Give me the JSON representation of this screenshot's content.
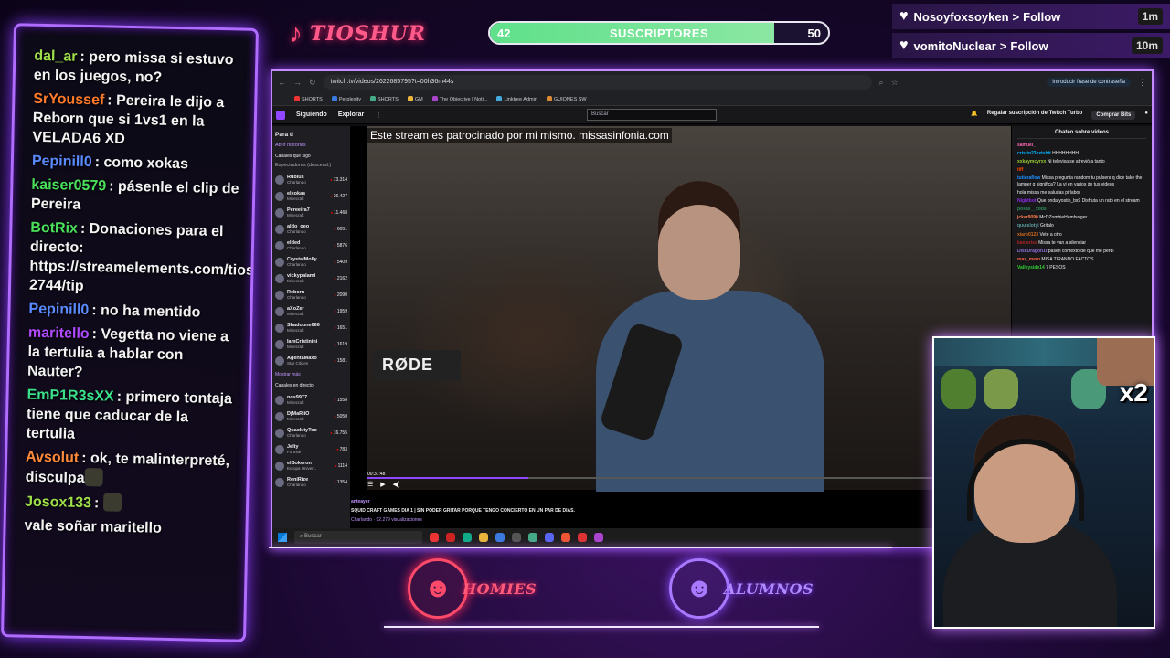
{
  "overlay": {
    "brand": "TIOSHUR",
    "subs": {
      "current": "42",
      "label": "SUSCRIPTORES",
      "goal": "50",
      "progress": 0.84
    },
    "follows": [
      {
        "user": "Nosoyfoxsoyken",
        "action": "Follow",
        "time": "1m"
      },
      {
        "user": "vomitoNuclear",
        "action": "Follow",
        "time": "10m"
      }
    ],
    "logos": {
      "homies": "HOMIES",
      "alumnos": "ALUMNOS"
    },
    "webcam_multiplier": "x2"
  },
  "overlay_chat": [
    {
      "user": "dal_ar",
      "color": "#9fe04a",
      "text": "pero missa si estuvo en los juegos, no?"
    },
    {
      "user": "SrYoussef",
      "color": "#ff7a2a",
      "text": "Pereira le dijo a Reborn que si 1vs1 en la VELADA6 XD"
    },
    {
      "user": "Pepinill0",
      "color": "#5a8aff",
      "text": "como xokas"
    },
    {
      "user": "kaiser0579",
      "color": "#4ae05a",
      "text": "pásenle el clip de Pereira"
    },
    {
      "user": "BotRix",
      "color": "#4ae05a",
      "text": "Donaciones para el directo: https://streamelements.com/tioshur-2744/tip"
    },
    {
      "user": "Pepinill0",
      "color": "#5a8aff",
      "text": "no ha mentido"
    },
    {
      "user": "maritello",
      "color": "#b04aff",
      "text": "Vegetta no viene a la tertulia a hablar con Nauter?"
    },
    {
      "user": "EmP1R3sXX",
      "color": "#3ae08a",
      "text": "primero tontaja tiene que caducar de la tertulia"
    },
    {
      "user": "Avsolut",
      "color": "#ff8a3a",
      "text": "ok, te malinterpreté, disculpa"
    },
    {
      "user": "Josox133",
      "color": "#9fe04a",
      "text": ""
    },
    {
      "user": "",
      "color": "#ffffff",
      "text": "vale soñar maritello"
    }
  ],
  "browser": {
    "url": "twitch.tv/videos/2622685795?t=00h36m44s",
    "password_prompt": "Introducir frase de contraseña",
    "bookmarks": [
      "SHORTS",
      "Perplexity",
      "SHORTS",
      "GM",
      "The Objective | Noti...",
      "Linktree Admin",
      "GUIONES SW"
    ]
  },
  "twitch": {
    "nav": {
      "following": "Siguiendo",
      "browse": "Explorar",
      "search_placeholder": "Buscar",
      "turbo": "Regalar suscripción de Twitch Turbo",
      "bits": "Comprar Bits"
    },
    "sidebar": {
      "for_you": "Para ti",
      "open_stories": "Abrir historias",
      "followed_header": "Canales que sigo",
      "sort": "Espectadores (descend.)",
      "followed": [
        {
          "name": "Rubius",
          "game": "Charlando",
          "viewers": "73.314"
        },
        {
          "name": "elxokas",
          "game": "Minecraft",
          "viewers": "26.427"
        },
        {
          "name": "Pereeira7",
          "game": "Minecraft",
          "viewers": "11.468"
        },
        {
          "name": "aldo_geo",
          "game": "Charlando",
          "viewers": "6051"
        },
        {
          "name": "elded",
          "game": "Charlando",
          "viewers": "5876"
        },
        {
          "name": "CrystalMolly",
          "game": "Charlando",
          "viewers": "5409"
        },
        {
          "name": "vickypalami",
          "game": "Minecraft",
          "viewers": "2162"
        },
        {
          "name": "Reborn",
          "game": "Charlando",
          "viewers": "2090"
        },
        {
          "name": "aXoZer",
          "game": "Minecraft",
          "viewers": "1959"
        },
        {
          "name": "Shadoune666",
          "game": "Minecraft",
          "viewers": "1651"
        },
        {
          "name": "IamCristinini",
          "game": "Minecraft",
          "viewers": "1619"
        },
        {
          "name": "AgentaMaxo",
          "game": "Star Citizen",
          "viewers": "1581"
        }
      ],
      "show_more": "Mostrar más",
      "live_header": "Canales en directo",
      "live": [
        {
          "name": "nos9977",
          "game": "Minecraft",
          "viewers": "1558"
        },
        {
          "name": "DjMaRiiO",
          "game": "Minecraft",
          "viewers": "5050"
        },
        {
          "name": "QuackityToo",
          "game": "Charlando",
          "viewers": "16.755"
        },
        {
          "name": "Jelty",
          "game": "Fortnite",
          "viewers": "783"
        },
        {
          "name": "elBokeron",
          "game": "Europa Univer...",
          "viewers": "1114"
        },
        {
          "name": "ReniRize",
          "game": "Charlando",
          "viewers": "1354"
        }
      ]
    },
    "player": {
      "sponsor": "Este stream es patrocinado por mi mismo. missasinfonia.com",
      "mic_brand": "RØDE",
      "timestamp": "00:37:48",
      "progress": 0.25
    },
    "video_info": {
      "channel": "anteayer",
      "title": "SQUID CRAFT GAMES DIA 1 | SIN PODER GRITAR PORQUE TENGO CONCIERTO EN UN PAR DE DIAS.",
      "meta": "Charlando · 92.279 visualizaciones"
    },
    "chat": {
      "header": "Chateo sobre vídeos",
      "lines": [
        {
          "user": "samuel_",
          "text": ""
        },
        {
          "user": "cristin23xxtshit",
          "text": "HHHHHHHH"
        },
        {
          "user": "xxkaymcyrxx",
          "text": "Ni televisa se atrevió a tanto"
        },
        {
          "user": "tiff",
          "text": ""
        },
        {
          "user": "tutiaraflow",
          "text": "Missa pregunta random tu pulsera q dice take the lamper q significa? La vi en varios de tus videos"
        },
        {
          "user": "",
          "text": "hola missa me saludas pirlabor"
        },
        {
          "user": "Nightbot",
          "text": "Que onda yostin_bs9 Disfruta un rato en el stream"
        },
        {
          "user": "posas__xdds",
          "text": ""
        },
        {
          "user": "jcker9090",
          "text": "McDZombieHamburger"
        },
        {
          "user": "quuislotyi",
          "text": "Gritalo"
        },
        {
          "user": "xiaro0123",
          "text": "Vete a otro"
        },
        {
          "user": "kanjeriss",
          "text": "Missa te van a silenciar"
        },
        {
          "user": "DiscDragon1t",
          "text": "pasen contexto de qué me perdí"
        },
        {
          "user": "mas_mern",
          "text": "MISA TIRANDO FACTOS"
        },
        {
          "user": "Valleyside14",
          "text": "7 PESOS"
        }
      ]
    }
  },
  "taskbar": {
    "search": "Buscar"
  }
}
